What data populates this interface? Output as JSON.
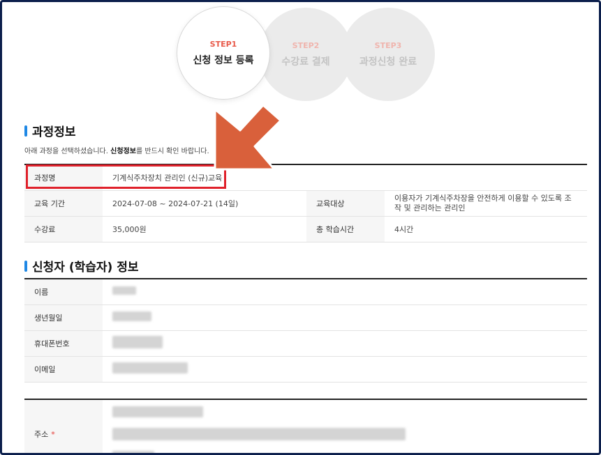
{
  "steps": [
    {
      "num": "STEP1",
      "label": "신청 정보 등록",
      "active": true
    },
    {
      "num": "STEP2",
      "label": "수강료 결제",
      "active": false
    },
    {
      "num": "STEP3",
      "label": "과정신청 완료",
      "active": false
    }
  ],
  "course_section": {
    "title": "과정정보",
    "note_prefix": "아래 과정을 선택하셨습니다. ",
    "note_bold": "신청정보",
    "note_suffix": "를 반드시 확인 바랍니다.",
    "course_name_label": "과정명",
    "course_name": "기계식주차장치 관리인 (신규)교육",
    "period_label": "교육 기간",
    "period": "2024-07-08 ~ 2024-07-21 (14일)",
    "target_label": "교육대상",
    "target": "이용자가 기계식주차장을 안전하게 이용할 수 있도록 조작 및 관리하는 관리인",
    "fee_label": "수강료",
    "fee": "35,000원",
    "hours_label": "총 학습시간",
    "hours": "4시간"
  },
  "applicant_section": {
    "title": "신청자 (학습자) 정보",
    "name_label": "이름",
    "birth_label": "생년월일",
    "phone_label": "휴대폰번호",
    "email_label": "이메일",
    "address_label": "주소",
    "required_mark": "*"
  },
  "colors": {
    "accent_blue": "#1f88e5",
    "step_active": "#e85a4a",
    "highlight_red": "#e0212b",
    "arrow_orange": "#d9603b",
    "frame": "#0c1f4c"
  }
}
